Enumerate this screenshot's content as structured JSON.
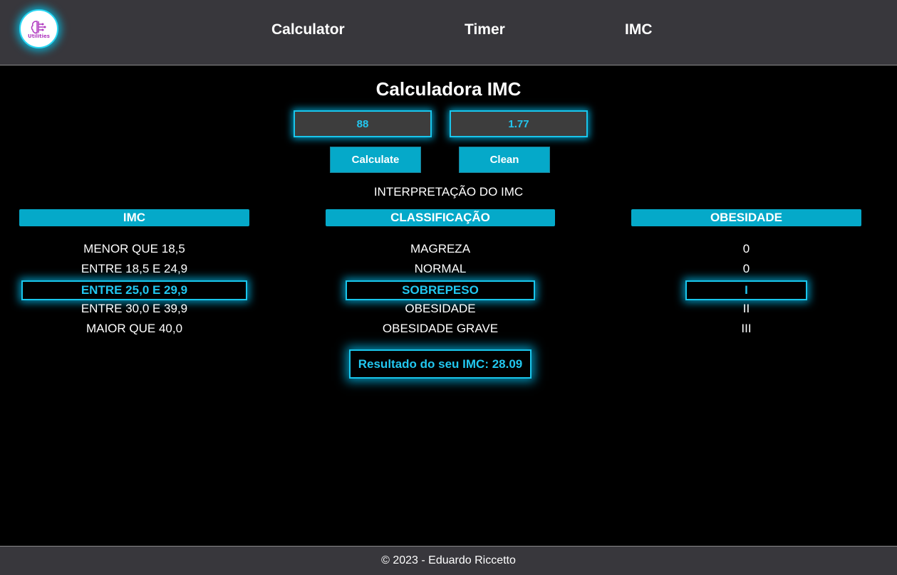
{
  "header": {
    "logo_text": "Utilities",
    "nav": [
      "Calculator",
      "Timer",
      "IMC"
    ]
  },
  "page": {
    "title": "Calculadora IMC",
    "weight_value": "88",
    "height_value": "1.77",
    "calculate_label": "Calculate",
    "clean_label": "Clean",
    "subtitle": "INTERPRETAÇÃO DO IMC"
  },
  "table": {
    "headers": [
      "IMC",
      "CLASSIFICAÇÃO",
      "OBESIDADE"
    ],
    "rows": [
      [
        "MENOR QUE 18,5",
        "MAGREZA",
        "0"
      ],
      [
        "ENTRE 18,5 E 24,9",
        "NORMAL",
        "0"
      ],
      [
        "ENTRE 25,0 E 29,9",
        "SOBREPESO",
        "I"
      ],
      [
        "ENTRE 30,0 E 39,9",
        "OBESIDADE",
        "II"
      ],
      [
        "MAIOR QUE 40,0",
        "OBESIDADE GRAVE",
        "III"
      ]
    ],
    "highlighted_row": 2
  },
  "result": "Resultado do seu IMC: 28.09",
  "footer": "© 2023 - Eduardo Riccetto",
  "colors": {
    "accent": "#05a9c9",
    "glow": "#19c6ec",
    "header_bg": "#38373c",
    "logo_text": "#b03ac0"
  }
}
